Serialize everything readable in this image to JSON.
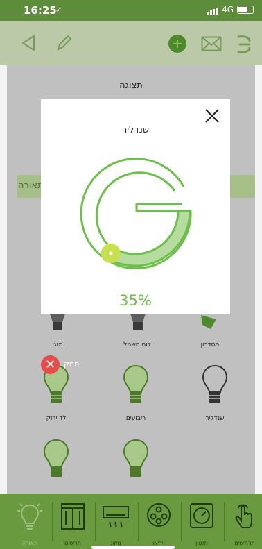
{
  "status_bar": {
    "time": "16:25",
    "network": "4G"
  },
  "screen": {
    "title": "תצוגה",
    "section_label": "תאורה"
  },
  "devices": [
    {
      "label": "מזגן"
    },
    {
      "label": "לוח חשמל"
    },
    {
      "label": "מסדרון"
    },
    {
      "label": "לד ירוק"
    },
    {
      "label": "ריבועים"
    },
    {
      "label": "שנדליר"
    }
  ],
  "delete": {
    "label": "מחק"
  },
  "modal": {
    "title": "שנדליר",
    "percentage_text": "35%",
    "level": 0.35,
    "accent_color": "#6dbf4b"
  },
  "bottom_nav": [
    {
      "label": "תאורה",
      "icon": "bulb-icon"
    },
    {
      "label": "תריסים",
      "icon": "shutter-icon"
    },
    {
      "label": "מיזוג",
      "icon": "ac-icon"
    },
    {
      "label": "וידיאו",
      "icon": "film-reel-icon"
    },
    {
      "label": "תזמון",
      "icon": "timer-icon"
    },
    {
      "label": "תרחישים",
      "icon": "hand-touch-icon"
    }
  ],
  "colors": {
    "brand_green": "#6a9a40",
    "status_green": "#5d8c3a",
    "delete_red": "#e64c4c"
  }
}
